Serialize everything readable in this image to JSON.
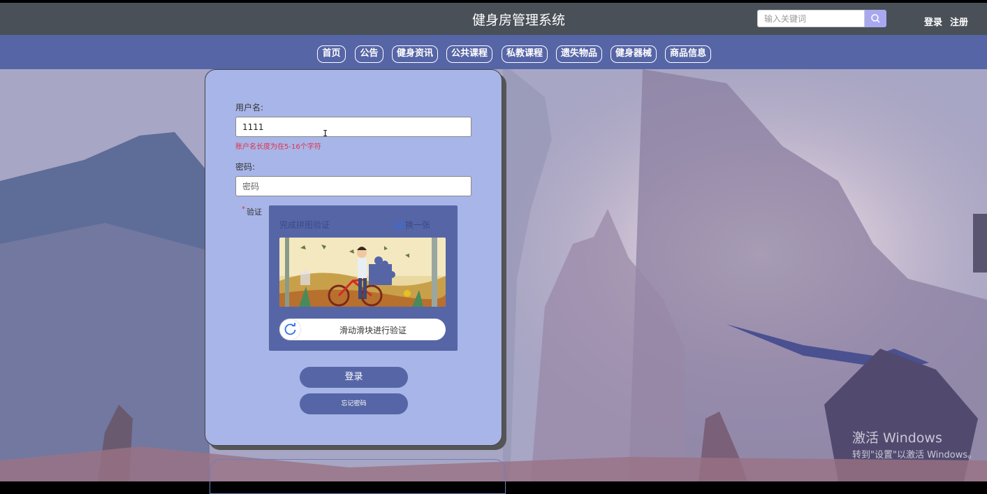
{
  "header": {
    "title": "健身房管理系统",
    "search_placeholder": "输入关键词",
    "login_link": "登录",
    "register_link": "注册"
  },
  "nav": {
    "items": [
      {
        "label": "首页"
      },
      {
        "label": "公告"
      },
      {
        "label": "健身资讯"
      },
      {
        "label": "公共课程"
      },
      {
        "label": "私教课程"
      },
      {
        "label": "遗失物品"
      },
      {
        "label": "健身器械"
      },
      {
        "label": "商品信息"
      }
    ]
  },
  "form": {
    "username_label": "用户名:",
    "username_value": "1111",
    "username_error": "账户名长度为在5-16个字符",
    "password_label": "密码:",
    "password_placeholder": "密码",
    "captcha_required_mark": "*",
    "captcha_label": "验证",
    "login_button": "登录",
    "forgot_button": "忘记密码"
  },
  "captcha": {
    "title": "完成拼图验证",
    "refresh_label": "换一张",
    "slider_text": "滑动滑块进行验证"
  },
  "watermark": {
    "title": "激活 Windows",
    "subtitle": "转到\"设置\"以激活 Windows。"
  },
  "colors": {
    "topbar": "#4a5058",
    "navbar": "#5665a6",
    "panel": "#a8b5e8",
    "button": "#5665a6",
    "error": "#e0334a",
    "search_button": "#a8a8f0"
  }
}
